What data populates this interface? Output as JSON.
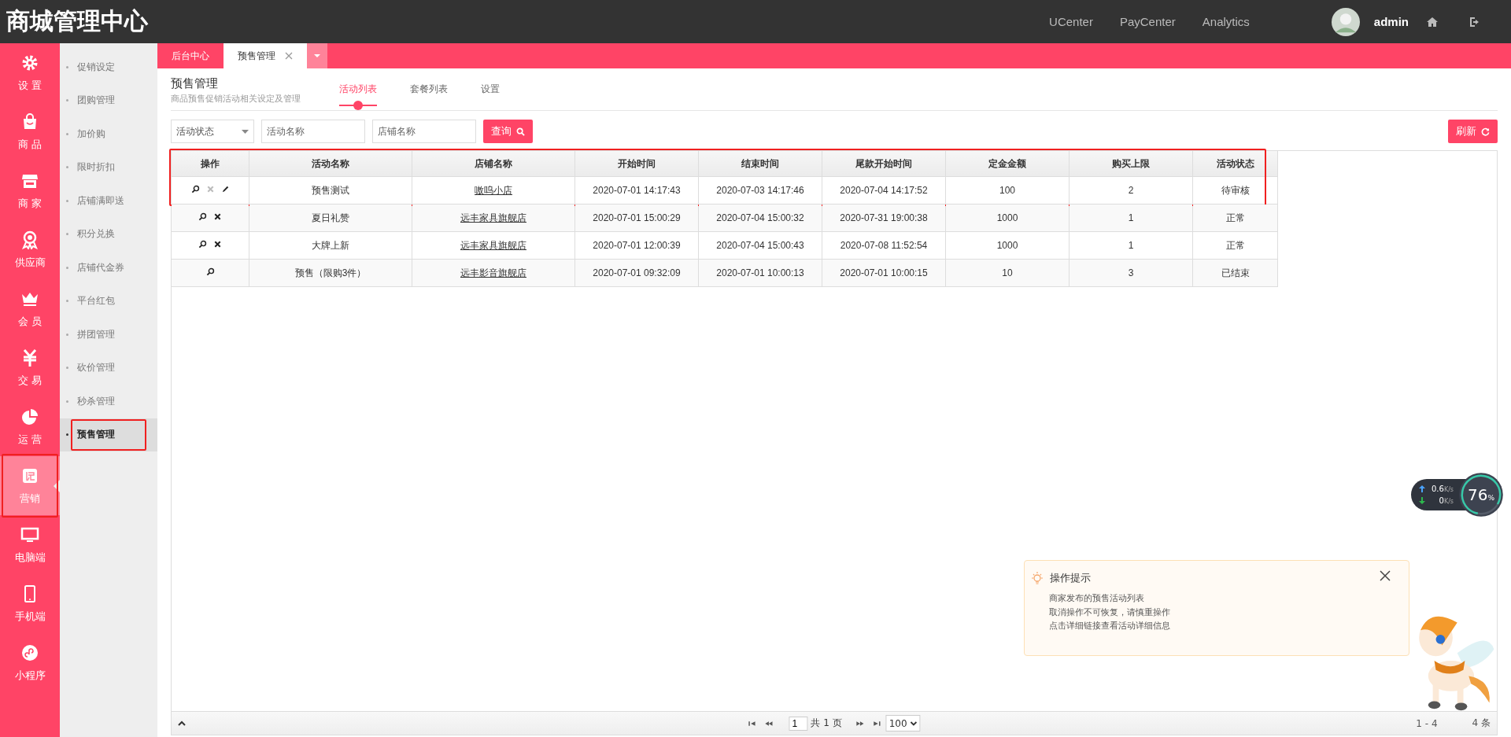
{
  "header": {
    "title": "商城管理中心",
    "links": [
      "UCenter",
      "PayCenter",
      "Analytics"
    ],
    "user": "admin"
  },
  "sidebar": {
    "items": [
      {
        "label": "设 置",
        "selected": false,
        "annotated": false
      },
      {
        "label": "商 品",
        "selected": false,
        "annotated": false
      },
      {
        "label": "商 家",
        "selected": false,
        "annotated": false
      },
      {
        "label": "供应商",
        "selected": false,
        "annotated": false
      },
      {
        "label": "会 员",
        "selected": false,
        "annotated": false
      },
      {
        "label": "交 易",
        "selected": false,
        "annotated": false
      },
      {
        "label": "运 营",
        "selected": false,
        "annotated": false
      },
      {
        "label": "营销",
        "selected": true,
        "annotated": true
      },
      {
        "label": "电脑端",
        "selected": false,
        "annotated": false
      },
      {
        "label": "手机端",
        "selected": false,
        "annotated": false
      },
      {
        "label": "小程序",
        "selected": false,
        "annotated": false
      }
    ]
  },
  "subnav": {
    "items": [
      {
        "label": "促销设定",
        "selected": false,
        "annotated": false
      },
      {
        "label": "团购管理",
        "selected": false,
        "annotated": false
      },
      {
        "label": "加价购",
        "selected": false,
        "annotated": false
      },
      {
        "label": "限时折扣",
        "selected": false,
        "annotated": false
      },
      {
        "label": "店铺满即送",
        "selected": false,
        "annotated": false
      },
      {
        "label": "积分兑换",
        "selected": false,
        "annotated": false
      },
      {
        "label": "店铺代金券",
        "selected": false,
        "annotated": false
      },
      {
        "label": "平台红包",
        "selected": false,
        "annotated": false
      },
      {
        "label": "拼团管理",
        "selected": false,
        "annotated": false
      },
      {
        "label": "砍价管理",
        "selected": false,
        "annotated": false
      },
      {
        "label": "秒杀管理",
        "selected": false,
        "annotated": false
      },
      {
        "label": "预售管理",
        "selected": true,
        "annotated": true
      }
    ]
  },
  "page_tabs": [
    {
      "label": "后台中心",
      "selected": false,
      "closable": false
    },
    {
      "label": "预售管理",
      "selected": true,
      "closable": true
    }
  ],
  "page": {
    "title": "预售管理",
    "subtitle": "商品预售促销活动相关设定及管理"
  },
  "tabs": [
    {
      "label": "活动列表",
      "selected": true
    },
    {
      "label": "套餐列表",
      "selected": false
    },
    {
      "label": "设置",
      "selected": false
    }
  ],
  "filters": {
    "status": {
      "value": "活动状态"
    },
    "name": {
      "placeholder": "活动名称"
    },
    "shop": {
      "placeholder": "店铺名称"
    },
    "search_button": "查询",
    "refresh_button": "刷新"
  },
  "table": {
    "action_column": "操作",
    "columns": [
      "活动名称",
      "店铺名称",
      "开始时间",
      "结束时间",
      "尾款开始时间",
      "定金金额",
      "购买上限",
      "活动状态"
    ],
    "rows": [
      {
        "annotated": true,
        "actions": [
          {
            "kind": "view",
            "disabled": false
          },
          {
            "kind": "delete",
            "disabled": true
          },
          {
            "kind": "edit",
            "disabled": false
          }
        ],
        "cells": [
          "预售测试",
          "嗷呜小店",
          "2020-07-01 14:17:43",
          "2020-07-03 14:17:46",
          "2020-07-04 14:17:52",
          "100",
          "2",
          "待审核"
        ]
      },
      {
        "annotated": false,
        "actions": [
          {
            "kind": "view",
            "disabled": false
          },
          {
            "kind": "delete",
            "disabled": false
          }
        ],
        "cells": [
          "夏日礼赞",
          "远丰家具旗舰店",
          "2020-07-01 15:00:29",
          "2020-07-04 15:00:32",
          "2020-07-31 19:00:38",
          "1000",
          "1",
          "正常"
        ]
      },
      {
        "annotated": false,
        "actions": [
          {
            "kind": "view",
            "disabled": false
          },
          {
            "kind": "delete",
            "disabled": false
          }
        ],
        "cells": [
          "大牌上新",
          "远丰家具旗舰店",
          "2020-07-01 12:00:39",
          "2020-07-04 15:00:43",
          "2020-07-08 11:52:54",
          "1000",
          "1",
          "正常"
        ]
      },
      {
        "annotated": false,
        "actions": [
          {
            "kind": "view",
            "disabled": false
          }
        ],
        "cells": [
          "预售（限购3件）",
          "远丰影音旗舰店",
          "2020-07-01 09:32:09",
          "2020-07-01 10:00:13",
          "2020-07-01 10:00:15",
          "10",
          "3",
          "已结束"
        ]
      }
    ]
  },
  "pager": {
    "page": "1",
    "total_pages": "共 1 页",
    "page_size": "100",
    "range": "1 - 4",
    "count": "4 条"
  },
  "net_widget": {
    "up": "0.6",
    "up_unit": "K/s",
    "down": "0",
    "down_unit": "K/s",
    "percent": "76",
    "percent_sign": "%"
  },
  "tip": {
    "title": "操作提示",
    "lines": [
      "商家发布的预售活动列表",
      "取消操作不可恢复，请慎重操作",
      "点击详细链接查看活动详细信息"
    ]
  }
}
